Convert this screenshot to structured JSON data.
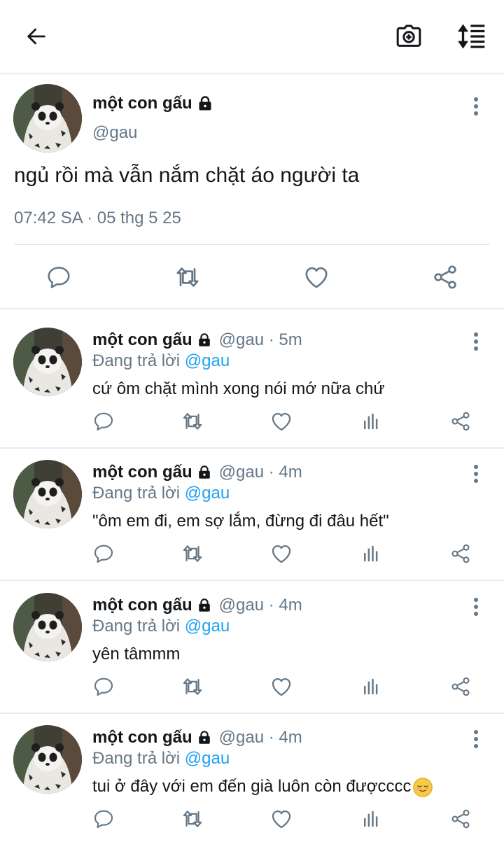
{
  "header": {
    "back_icon": "arrow-left-icon",
    "camera_icon": "camera-plus-icon",
    "sort_icon": "sort-lines-icon"
  },
  "main_tweet": {
    "name": "một con gấu",
    "handle": "@gau",
    "text": "ngủ rồi mà vẫn nắm chặt áo người ta",
    "timestamp": "07:42 SA · 05 thg 5 25",
    "lock_icon": "lock-icon"
  },
  "replies": [
    {
      "name": "một con gấu",
      "handle_time": "@gau · 5m",
      "replying_prefix": "Đang trả lời",
      "replying_to": "@gau",
      "text": "cứ ôm chặt mình xong nói mớ nữa chứ"
    },
    {
      "name": "một con gấu",
      "handle_time": "@gau · 4m",
      "replying_prefix": "Đang trả lời",
      "replying_to": "@gau",
      "text": "\"ôm em đi, em sợ lắm, đừng đi đâu hết\""
    },
    {
      "name": "một con gấu",
      "handle_time": "@gau · 4m",
      "replying_prefix": "Đang trả lời",
      "replying_to": "@gau",
      "text": "yên tâmmm"
    },
    {
      "name": "một con gấu",
      "handle_time": "@gau · 4m",
      "replying_prefix": "Đang trả lời",
      "replying_to": "@gau",
      "text": "tui ở đây với em đến già luôn còn đượcccc"
    }
  ],
  "colors": {
    "accent": "#1da1f2",
    "muted": "#657786",
    "text": "#14171a",
    "divider": "#e6ecf0"
  }
}
